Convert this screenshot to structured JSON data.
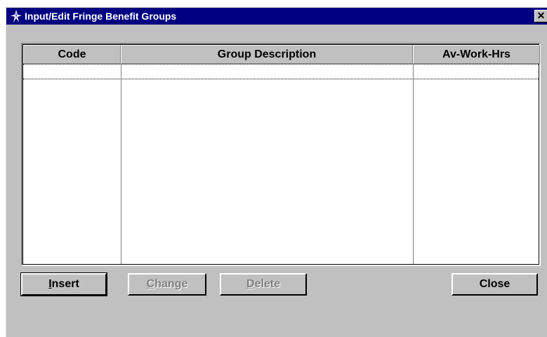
{
  "window": {
    "title": "Input/Edit Fringe Benefit Groups",
    "close_glyph": "✕"
  },
  "grid": {
    "columns": [
      {
        "label": "Code"
      },
      {
        "label": "Group Description"
      },
      {
        "label": "Av-Work-Hrs"
      }
    ],
    "rows": [
      {
        "code": "",
        "description": "",
        "av_work_hrs": ""
      }
    ]
  },
  "buttons": {
    "insert": {
      "accel": "I",
      "rest": "nsert",
      "enabled": true
    },
    "change": {
      "accel": "C",
      "rest": "hange",
      "enabled": false
    },
    "delete": {
      "accel": "D",
      "rest": "elete",
      "enabled": false
    },
    "close": {
      "label": "Close",
      "enabled": true
    }
  },
  "colors": {
    "title_bar": "#000080",
    "face": "#c0c0c0",
    "disabled_text": "#808080"
  }
}
